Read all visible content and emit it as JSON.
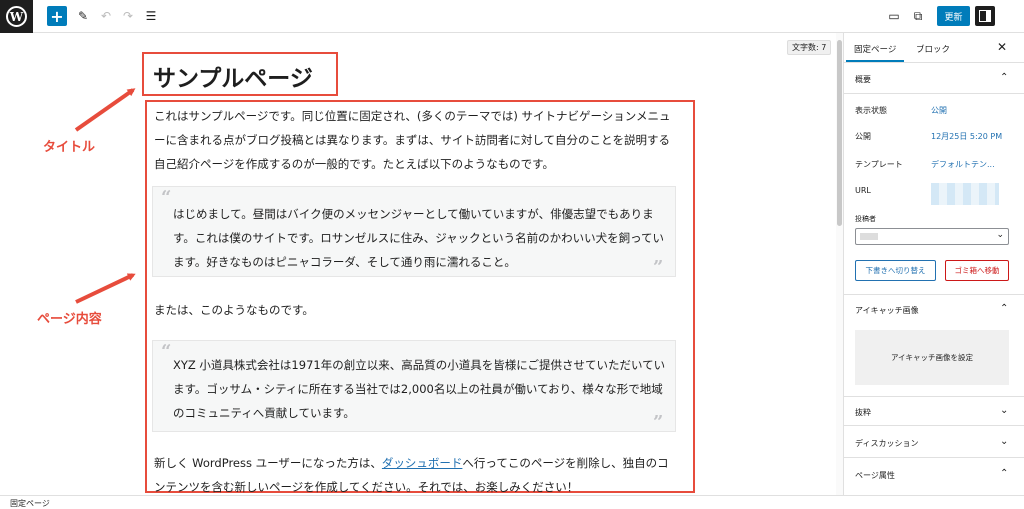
{
  "toolbar": {
    "logo": "W",
    "add_icon": "+",
    "pen_icon": "✎",
    "undo_icon": "↶",
    "redo_icon": "↷",
    "list_icon": "☰",
    "desktop_icon": "▭",
    "external_icon": "⧉",
    "update_label": "更新"
  },
  "editor": {
    "word_count": "文字数: 7",
    "title": "サンプルページ",
    "paragraph1": "これはサンプルページです。同じ位置に固定され、(多くのテーマでは) サイトナビゲーションメニューに含まれる点がブログ投稿とは異なります。まずは、サイト訪問者に対して自分のことを説明する自己紹介ページを作成するのが一般的です。たとえば以下のようなものです。",
    "quote1": "はじめまして。昼間はバイク便のメッセンジャーとして働いていますが、俳優志望でもあります。これは僕のサイトです。ロサンゼルスに住み、ジャックという名前のかわいい犬を飼っています。好きなものはピニャコラーダ、そして通り雨に濡れること。",
    "paragraph2": "または、このようなものです。",
    "quote2": "XYZ 小道具株式会社は1971年の創立以来、高品質の小道具を皆様にご提供させていただいています。ゴッサム・シティに所在する当社では2,000名以上の社員が働いており、様々な形で地域のコミュニティへ貢献しています。",
    "paragraph3_before": "新しく WordPress ユーザーになった方は、",
    "paragraph3_link": "ダッシュボード",
    "paragraph3_after": "へ行ってこのページを削除し、独自のコンテンツを含む新しいページを作成してください。それでは、お楽しみください！",
    "quote_open": "“",
    "quote_close": "”"
  },
  "annotations": {
    "title_label": "タイトル",
    "content_label": "ページ内容",
    "color": "#e74c3c"
  },
  "sidebar": {
    "tab_page": "固定ページ",
    "tab_block": "ブロック",
    "close_icon": "✕",
    "summary_title": "概要",
    "visibility_label": "表示状態",
    "visibility_value": "公開",
    "publish_label": "公開",
    "publish_value": "12月25日 5:20 PM",
    "template_label": "テンプレート",
    "template_value": "デフォルトテン...",
    "url_label": "URL",
    "author_label": "投稿者",
    "draft_button": "下書きへ切り替え",
    "trash_button": "ゴミ箱へ移動",
    "featured_title": "アイキャッチ画像",
    "featured_button": "アイキャッチ画像を設定",
    "excerpt_title": "抜粋",
    "discussion_title": "ディスカッション",
    "attributes_title": "ページ属性",
    "chevron_up": "⌃",
    "chevron_down": "⌄"
  },
  "footer": {
    "breadcrumb": "固定ページ"
  },
  "colors": {
    "accent": "#007cba",
    "link": "#2271b1",
    "danger": "#cc1818"
  }
}
